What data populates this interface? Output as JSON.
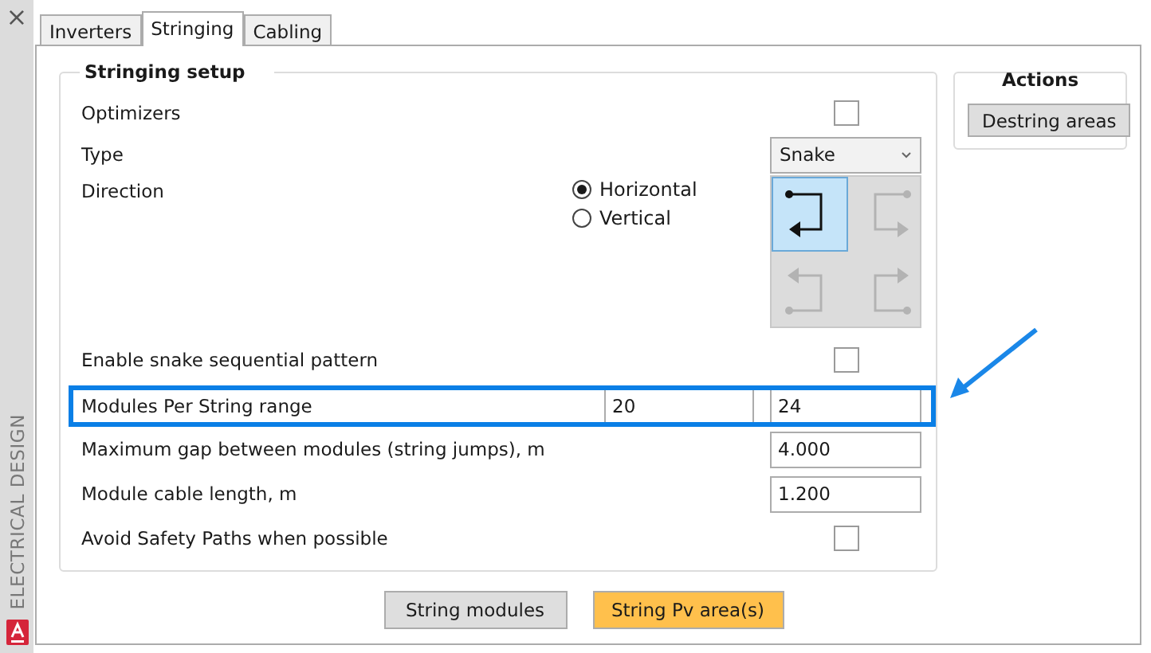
{
  "side_panel": {
    "close": "×",
    "title": "ELECTRICAL DESIGN"
  },
  "tabs": [
    {
      "label": "Inverters",
      "selected": false
    },
    {
      "label": "Stringing",
      "selected": true
    },
    {
      "label": "Cabling",
      "selected": false
    }
  ],
  "stringing_setup": {
    "title": "Stringing setup",
    "rows": [
      {
        "kind": "checkbox",
        "label": "Optimizers",
        "checked": false
      },
      {
        "kind": "select",
        "label": "Type",
        "value": "Snake"
      },
      {
        "kind": "direction",
        "label": "Direction",
        "options": [
          {
            "label": "Horizontal",
            "selected": true
          },
          {
            "label": "Vertical",
            "selected": false
          }
        ],
        "patterns": [
          {
            "selected": true
          },
          {
            "selected": false
          },
          {
            "selected": false
          },
          {
            "selected": false
          }
        ]
      },
      {
        "kind": "checkbox",
        "label": "Enable snake sequential pattern",
        "checked": false
      },
      {
        "kind": "range",
        "label": "Modules Per String range",
        "values": [
          "20",
          "24"
        ],
        "highlighted": true
      },
      {
        "kind": "number",
        "label": "Maximum gap between modules (string jumps), m",
        "value": "4.000"
      },
      {
        "kind": "number",
        "label": "Module cable length, m",
        "value": "1.200"
      },
      {
        "kind": "checkbox",
        "label": "Avoid Safety Paths when possible",
        "checked": false
      }
    ]
  },
  "actions": {
    "title": "Actions",
    "buttons": [
      "Destring areas"
    ]
  },
  "buttons": [
    {
      "label": "String modules",
      "primary": false
    },
    {
      "label": "String Pv area(s)",
      "primary": true
    }
  ]
}
